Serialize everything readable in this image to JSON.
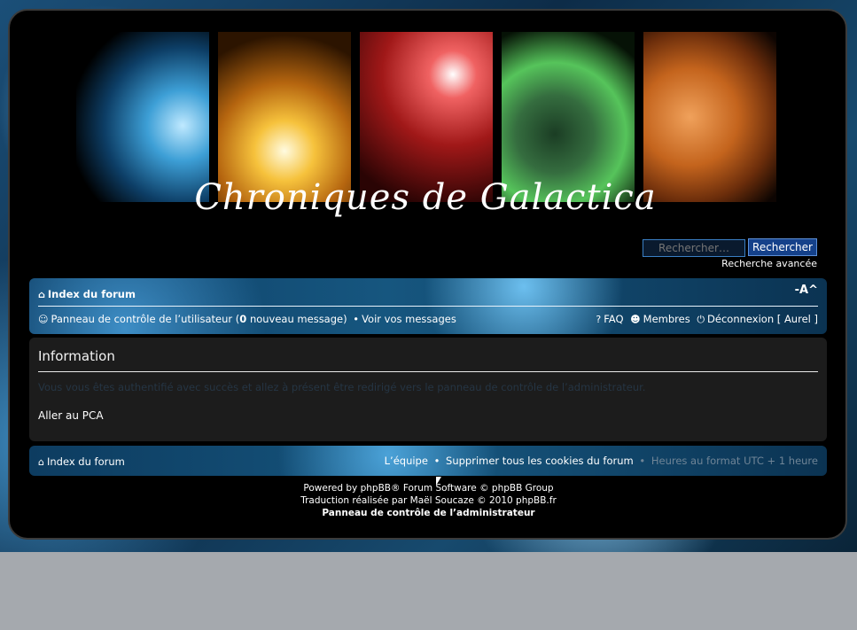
{
  "banner": {
    "title": "Chroniques de Galactica"
  },
  "search": {
    "placeholder": "Rechercher…",
    "button_label": "Rechercher",
    "advanced_label": "Recherche avancée"
  },
  "navbar": {
    "index_label": "Index du forum",
    "font_resize_label": "-A^",
    "ucp_label": "Panneau de contrôle de l’utilisateur",
    "new_msg_count": "0",
    "new_msg_label": "nouveau message",
    "view_messages_label": "Voir vos messages",
    "faq_label": "FAQ",
    "members_label": "Membres",
    "logout_label": "Déconnexion",
    "username": "Aurel"
  },
  "info": {
    "title": "Information",
    "message": "Vous vous êtes authentifié avec succès et allez à présent être redirigé vers le panneau de contrôle de l’administrateur.",
    "link_label": "Aller au PCA"
  },
  "footer": {
    "index_label": "Index du forum",
    "team_label": "L’équipe",
    "delete_cookies_label": "Supprimer tous les cookies du forum",
    "timezone_label": "Heures au format UTC + 1 heure"
  },
  "copyright": {
    "line1": "Powered by phpBB® Forum Software © phpBB Group",
    "line2": "Traduction réalisée par Maël Soucaze © 2010 phpBB.fr",
    "acp_label": "Panneau de contrôle de l’administrateur"
  },
  "colors": {
    "frame_bg": "#000000",
    "nav_blue": "#16567f",
    "panel_bg": "#1c1c1c",
    "page_bg": "#a5a9ae"
  },
  "icons": [
    "home-icon",
    "ucp-icon",
    "faq-icon",
    "members-icon",
    "logout-icon"
  ]
}
